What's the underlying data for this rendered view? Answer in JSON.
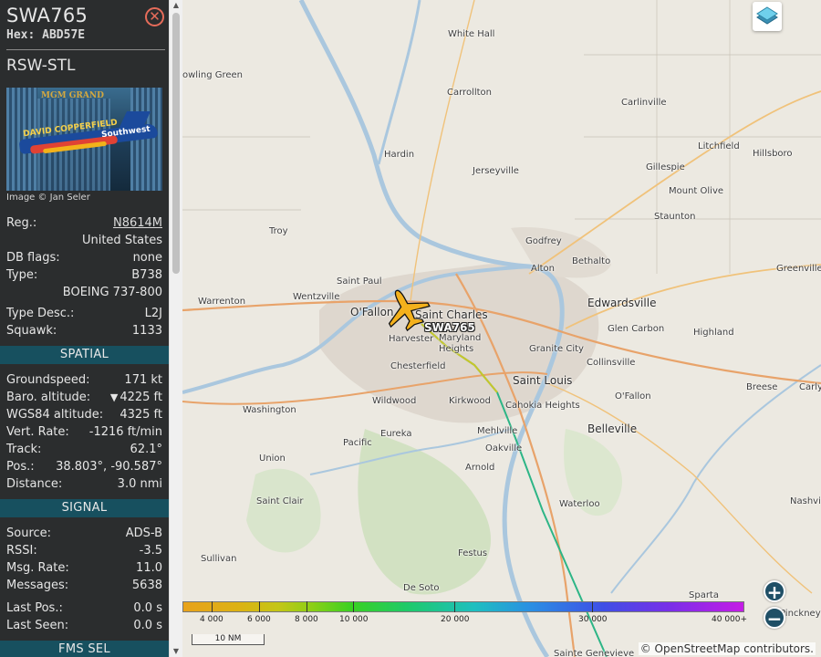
{
  "aircraft": {
    "callsign": "SWA765",
    "hex_label": "Hex:",
    "hex": "ABD57E",
    "route": "RSW-STL",
    "photo_credit": "Image © Jan Seler",
    "photo_brand": "Southwest",
    "photo_sign": "MGM GRAND",
    "photo_ad": "DAVID COPPERFIELD"
  },
  "info": [
    {
      "label": "Reg.:",
      "value": "N8614M"
    },
    {
      "label": "",
      "value": "United States"
    },
    {
      "label": "DB flags:",
      "value": "none"
    },
    {
      "label": "Type:",
      "value": "B738"
    },
    {
      "label": "",
      "value": "BOEING 737-800"
    },
    {
      "label": "Type Desc.:",
      "value": "L2J"
    },
    {
      "label": "Squawk:",
      "value": "1133"
    }
  ],
  "sections": {
    "spatial": "SPATIAL",
    "signal": "SIGNAL",
    "fms": "FMS SEL"
  },
  "spatial": [
    {
      "label": "Groundspeed:",
      "value": "171 kt"
    },
    {
      "label": "Baro. altitude:",
      "value": "4225 ft",
      "icon": "▼"
    },
    {
      "label": "WGS84 altitude:",
      "value": "4325 ft"
    },
    {
      "label": "Vert. Rate:",
      "value": "-1216 ft/min"
    },
    {
      "label": "Track:",
      "value": "62.1°"
    },
    {
      "label": "Pos.:",
      "value": "38.803°, -90.587°"
    },
    {
      "label": "Distance:",
      "value": "3.0 nmi"
    }
  ],
  "signal": [
    {
      "label": "Source:",
      "value": "ADS-B"
    },
    {
      "label": "RSSI:",
      "value": "-3.5"
    },
    {
      "label": "Msg. Rate:",
      "value": "11.0"
    },
    {
      "label": "Messages:",
      "value": "5638"
    },
    {
      "label": "Last Pos.:",
      "value": "0.0 s"
    },
    {
      "label": "Last Seen:",
      "value": "0.0 s"
    }
  ],
  "map": {
    "aircraft_label": "SWA765",
    "places": [
      "White Hall",
      "owling Green",
      "Carrollton",
      "Carlinville",
      "Litchfield",
      "Hillsboro",
      "Hardin",
      "Jerseyville",
      "Gillespie",
      "Mount Olive",
      "Staunton",
      "Troy",
      "Godfrey",
      "Alton",
      "Bethalto",
      "Saint Paul",
      "Greenville",
      "Warrenton",
      "Wentzville",
      "O'Fallon",
      "Saint Charles",
      "Edwardsville",
      "Maryland Heights",
      "Harvester",
      "Glen Carbon",
      "Granite City",
      "Highland",
      "Chesterfield",
      "Collinsville",
      "Saint Louis",
      "Breese",
      "Carlyl",
      "Wildwood",
      "Kirkwood",
      "Cahokia Heights",
      "O'Fallon",
      "Washington",
      "Belleville",
      "Eureka",
      "Mehlville",
      "Pacific",
      "Oakville",
      "Union",
      "Arnold",
      "Saint Clair",
      "Waterloo",
      "Nashvil",
      "Sullivan",
      "Festus",
      "De Soto",
      "Sparta",
      "Pinckney",
      "Sainte Genevieve"
    ],
    "legend_labels": [
      "4 000",
      "6 000",
      "8 000",
      "10 000",
      "20 000",
      "30 000",
      "40 000+"
    ],
    "scale": "10 NM",
    "attribution": "© OpenStreetMap contributors."
  },
  "colors": {
    "sidebar_bg": "#2b2d2e",
    "section_bg": "#17505f",
    "close": "#e66c5a",
    "aircraft_fill": "#f4b11c"
  }
}
